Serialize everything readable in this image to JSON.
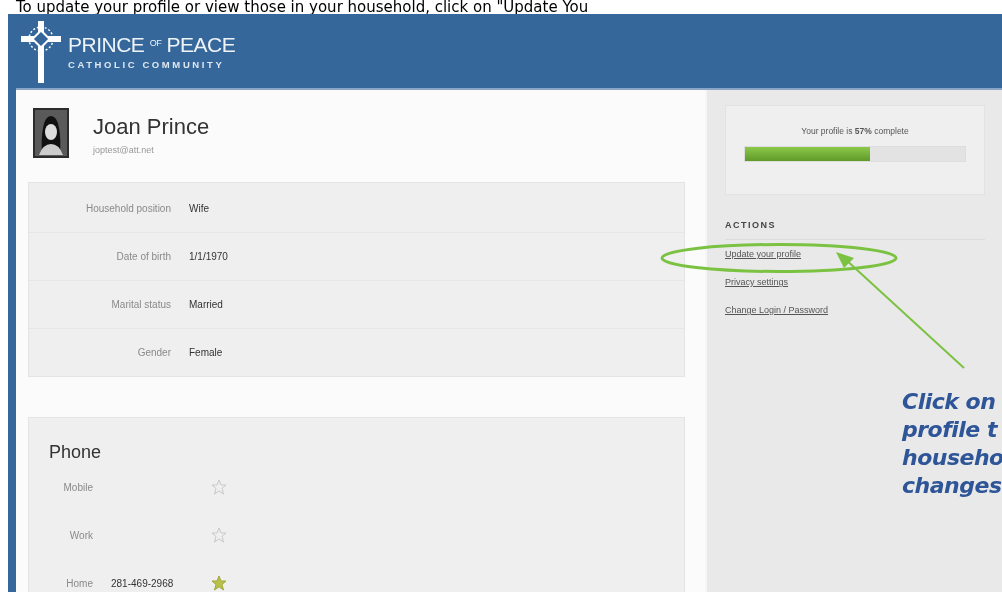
{
  "caption": "To update your profile or view those in your household, click on \"Update You",
  "header": {
    "logo_title": "PRINCE $^{OF}$ PEACE",
    "logo_subtitle": "CATHOLIC COMMUNITY"
  },
  "profile": {
    "name": "Joan Prince",
    "email": "joptest@att.net"
  },
  "details": [
    {
      "label": "Household position",
      "value": "Wife"
    },
    {
      "label": "Date of birth",
      "value": "1/1/1970"
    },
    {
      "label": "Marital status",
      "value": "Married"
    },
    {
      "label": "Gender",
      "value": "Female"
    }
  ],
  "phone": {
    "title": "Phone",
    "rows": [
      {
        "label": "Mobile",
        "value": "",
        "primary": false
      },
      {
        "label": "Work",
        "value": "",
        "primary": false
      },
      {
        "label": "Home",
        "value": "281-469-2968",
        "primary": true
      }
    ]
  },
  "profile_completion": {
    "text": "Your profile is **57%** complete",
    "level": 0.57
  },
  "actions": {
    "title": "ACTIONS",
    "links": [
      "Update your profile",
      "Privacy settings",
      "Change Login / Password"
    ]
  },
  "annotation": {
    "lines": [
      "Click on",
      "profile t",
      "househo",
      "changes"
    ]
  }
}
